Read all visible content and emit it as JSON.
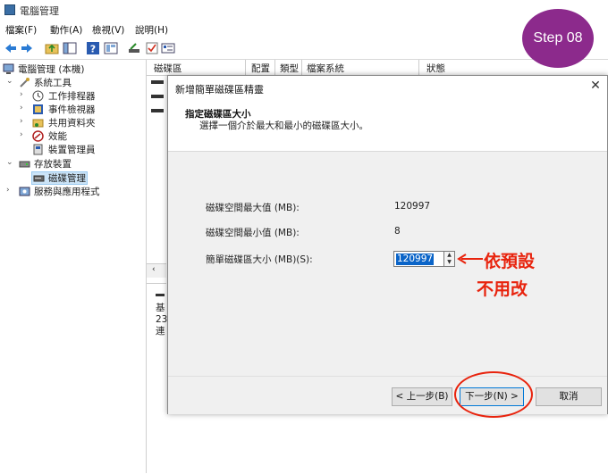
{
  "window": {
    "title": "電腦管理"
  },
  "menu": [
    "檔案(F)",
    "動作(A)",
    "檢視(V)",
    "說明(H)"
  ],
  "tree": {
    "root": "電腦管理 (本機)",
    "system_tools": "系統工具",
    "task_scheduler": "工作排程器",
    "event_viewer": "事件檢視器",
    "shared_folders": "共用資料夾",
    "performance": "效能",
    "device_manager": "裝置管理員",
    "storage": "存放裝置",
    "disk_management": "磁碟管理",
    "services": "服務與應用程式"
  },
  "columns": [
    "磁碟區",
    "配置",
    "類型",
    "檔案系統",
    "狀態"
  ],
  "lower_pane": {
    "line1": "基",
    "line2": "23",
    "line3": "連"
  },
  "wizard": {
    "title": "新增簡單磁碟區精靈",
    "heading": "指定磁碟區大小",
    "subheading": "選擇一個介於最大和最小的磁碟區大小。",
    "max_label": "磁碟空間最大值 (MB):",
    "max_value": "120997",
    "min_label": "磁碟空間最小值 (MB):",
    "min_value": "8",
    "size_label": "簡單磁碟區大小 (MB)(S):",
    "size_value": "120997",
    "back_button": "< 上一步(B)",
    "next_button": "下一步(N) >",
    "cancel_button": "取消"
  },
  "annotation": {
    "line1": "依預設",
    "line2": "不用改"
  },
  "step_badge": "Step 08"
}
